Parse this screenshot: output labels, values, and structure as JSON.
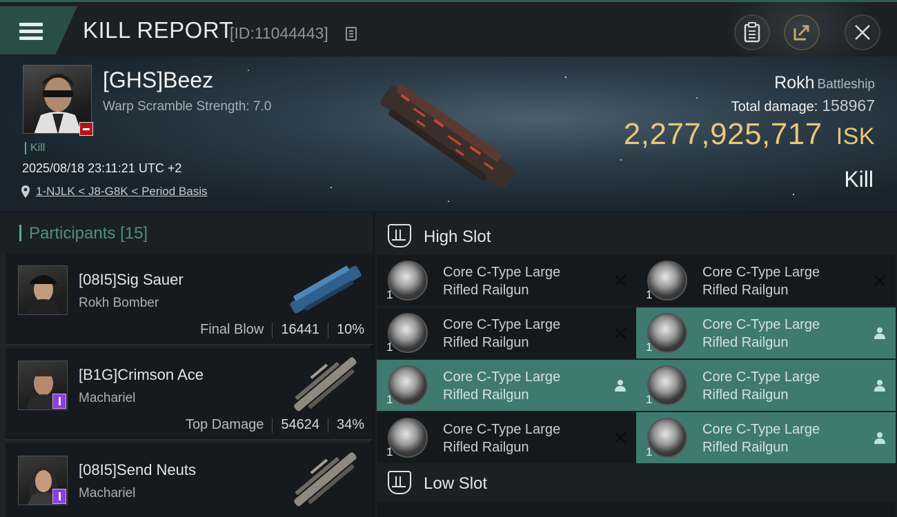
{
  "header": {
    "title": "KILL REPORT",
    "report_id": "[ID:11044443]"
  },
  "victim": {
    "name": "[GHS]Beez",
    "warp_scramble": "Warp Scramble Strength: 7.0",
    "kill_tag": "Kill",
    "datetime": "2025/08/18 23:11:21 UTC +2",
    "location": "1-NJLK < J8-G8K < Period Basis",
    "ship_name": "Rokh",
    "ship_class": "Battleship",
    "total_damage_label": "Total damage:",
    "total_damage": "158967",
    "isk_value": "2,277,925,717",
    "isk_unit": "ISK",
    "result": "Kill"
  },
  "participants": {
    "title": "Participants",
    "count": "[15]",
    "items": [
      {
        "name": "[08I5]Sig Sauer",
        "ship": "Rokh Bomber",
        "role": "Final Blow",
        "damage": "16441",
        "percent": "10%"
      },
      {
        "name": "[B1G]Crimson Ace",
        "ship": "Machariel",
        "role": "Top Damage",
        "damage": "54624",
        "percent": "34%"
      },
      {
        "name": "[08I5]Send Neuts",
        "ship": "Machariel"
      }
    ]
  },
  "slots": {
    "high": {
      "title": "High Slot",
      "modules": [
        {
          "line1": "Core C-Type Large",
          "line2": "Rifled Railgun",
          "qty": "1",
          "state": "destroyed"
        },
        {
          "line1": "Core C-Type Large",
          "line2": "Rifled Railgun",
          "qty": "1",
          "state": "destroyed"
        },
        {
          "line1": "Core C-Type Large",
          "line2": "Rifled Railgun",
          "qty": "1",
          "state": "destroyed"
        },
        {
          "line1": "Core C-Type Large",
          "line2": "Rifled Railgun",
          "qty": "1",
          "state": "dropped"
        },
        {
          "line1": "Core C-Type Large",
          "line2": "Rifled Railgun",
          "qty": "1",
          "state": "dropped"
        },
        {
          "line1": "Core C-Type Large",
          "line2": "Rifled Railgun",
          "qty": "1",
          "state": "dropped"
        },
        {
          "line1": "Core C-Type Large",
          "line2": "Rifled Railgun",
          "qty": "1",
          "state": "destroyed"
        },
        {
          "line1": "Core C-Type Large",
          "line2": "Rifled Railgun",
          "qty": "1",
          "state": "dropped"
        }
      ]
    },
    "low": {
      "title": "Low Slot"
    }
  },
  "colors": {
    "accent": "#4fb29c",
    "isk": "#e9c77a",
    "fitted": "#3f7a70",
    "badge_red": "#b0141a",
    "badge_purple": "#8d3de0"
  }
}
